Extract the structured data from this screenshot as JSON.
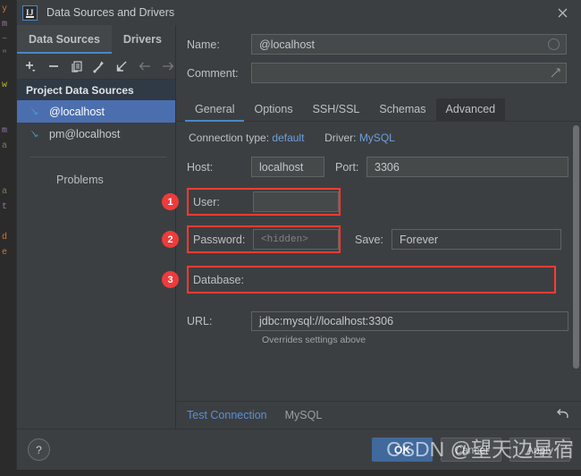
{
  "window": {
    "title": "Data Sources and Drivers",
    "app_icon": "intellij-idea-icon",
    "close_icon": "close-icon"
  },
  "left_pane": {
    "tabs": [
      {
        "label": "Data Sources",
        "active": true
      },
      {
        "label": "Drivers",
        "active": false
      }
    ],
    "toolbar": [
      {
        "name": "add-icon",
        "glyph": "+"
      },
      {
        "name": "remove-icon",
        "glyph": "−"
      },
      {
        "name": "copy-icon",
        "glyph": "⎘"
      },
      {
        "name": "wrench-icon",
        "glyph": "🔧"
      },
      {
        "name": "import-icon",
        "glyph": "↙"
      },
      {
        "name": "back-arrow-icon",
        "glyph": "←"
      },
      {
        "name": "forward-arrow-icon",
        "glyph": "→"
      }
    ],
    "group_header": "Project Data Sources",
    "items": [
      {
        "label": "@localhost",
        "selected": true,
        "icon": "mysql-icon"
      },
      {
        "label": "pm@localhost",
        "selected": false,
        "icon": "mysql-icon"
      }
    ],
    "problems_label": "Problems"
  },
  "form": {
    "name_label": "Name:",
    "name_value": "@localhost",
    "comment_label": "Comment:",
    "comment_value": "",
    "comment_placeholder": ""
  },
  "detail_tabs": [
    {
      "label": "General",
      "active": true
    },
    {
      "label": "Options",
      "active": false
    },
    {
      "label": "SSH/SSL",
      "active": false
    },
    {
      "label": "Schemas",
      "active": false
    },
    {
      "label": "Advanced",
      "active": false,
      "boxed": true
    }
  ],
  "general": {
    "connection_type_label": "Connection type:",
    "connection_type_value": "default",
    "driver_label": "Driver:",
    "driver_value": "MySQL",
    "host_label": "Host:",
    "host_value": "localhost",
    "port_label": "Port:",
    "port_value": "3306",
    "user_label": "User:",
    "user_value": "",
    "password_label": "Password:",
    "password_value": "<hidden>",
    "save_label": "Save:",
    "save_value": "Forever",
    "database_label": "Database:",
    "database_value": "",
    "url_label": "URL:",
    "url_value": "jdbc:mysql://localhost:3306",
    "url_hint": "Overrides settings above"
  },
  "annotations": [
    {
      "number": "1",
      "target": "user-field"
    },
    {
      "number": "2",
      "target": "password-field"
    },
    {
      "number": "3",
      "target": "database-field"
    }
  ],
  "test_row": {
    "test_connection_label": "Test Connection",
    "driver_name": "MySQL",
    "revert_icon": "revert-icon"
  },
  "footer": {
    "help_label": "?",
    "ok_label": "OK",
    "cancel_label": "Cancel",
    "apply_label": "Apply"
  },
  "watermark": "CSDN @望天边星宿",
  "colors": {
    "dialog_bg": "#3c3f41",
    "accent_blue": "#4a88c7",
    "selection_blue": "#4b6eaf",
    "primary_button": "#41699c",
    "annotation_red": "#ff3b30",
    "badge_red": "#ef3b3b",
    "link_blue": "#5b8fd4",
    "group_header_bg": "#2f3a45"
  },
  "code_backdrop": [
    "y",
    "m",
    "~",
    "\"",
    "",
    "w",
    "",
    "",
    "m",
    "a",
    "",
    "",
    "a",
    "t",
    "",
    "d",
    "e"
  ]
}
